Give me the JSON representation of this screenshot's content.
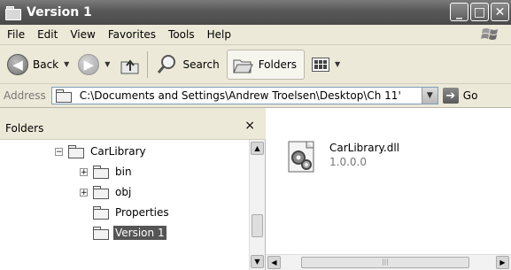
{
  "window": {
    "title": "Version 1"
  },
  "menu": [
    "File",
    "Edit",
    "View",
    "Favorites",
    "Tools",
    "Help"
  ],
  "toolbar": {
    "back_label": "Back",
    "search_label": "Search",
    "folders_label": "Folders"
  },
  "address": {
    "label": "Address",
    "path": "C:\\Documents and Settings\\Andrew Troelsen\\Desktop\\Ch 11'",
    "go_label": "Go"
  },
  "folders_pane": {
    "title": "Folders",
    "close": "×",
    "tree": [
      {
        "label": "CarLibrary",
        "expander": "−"
      },
      {
        "label": "bin",
        "expander": "+"
      },
      {
        "label": "obj",
        "expander": "+"
      },
      {
        "label": "Properties",
        "expander": ""
      },
      {
        "label": "Version 1",
        "expander": "",
        "selected": true
      }
    ]
  },
  "content": {
    "file": {
      "name": "CarLibrary.dll",
      "version": "1.0.0.0",
      "icon": "gear-dll-icon"
    }
  }
}
